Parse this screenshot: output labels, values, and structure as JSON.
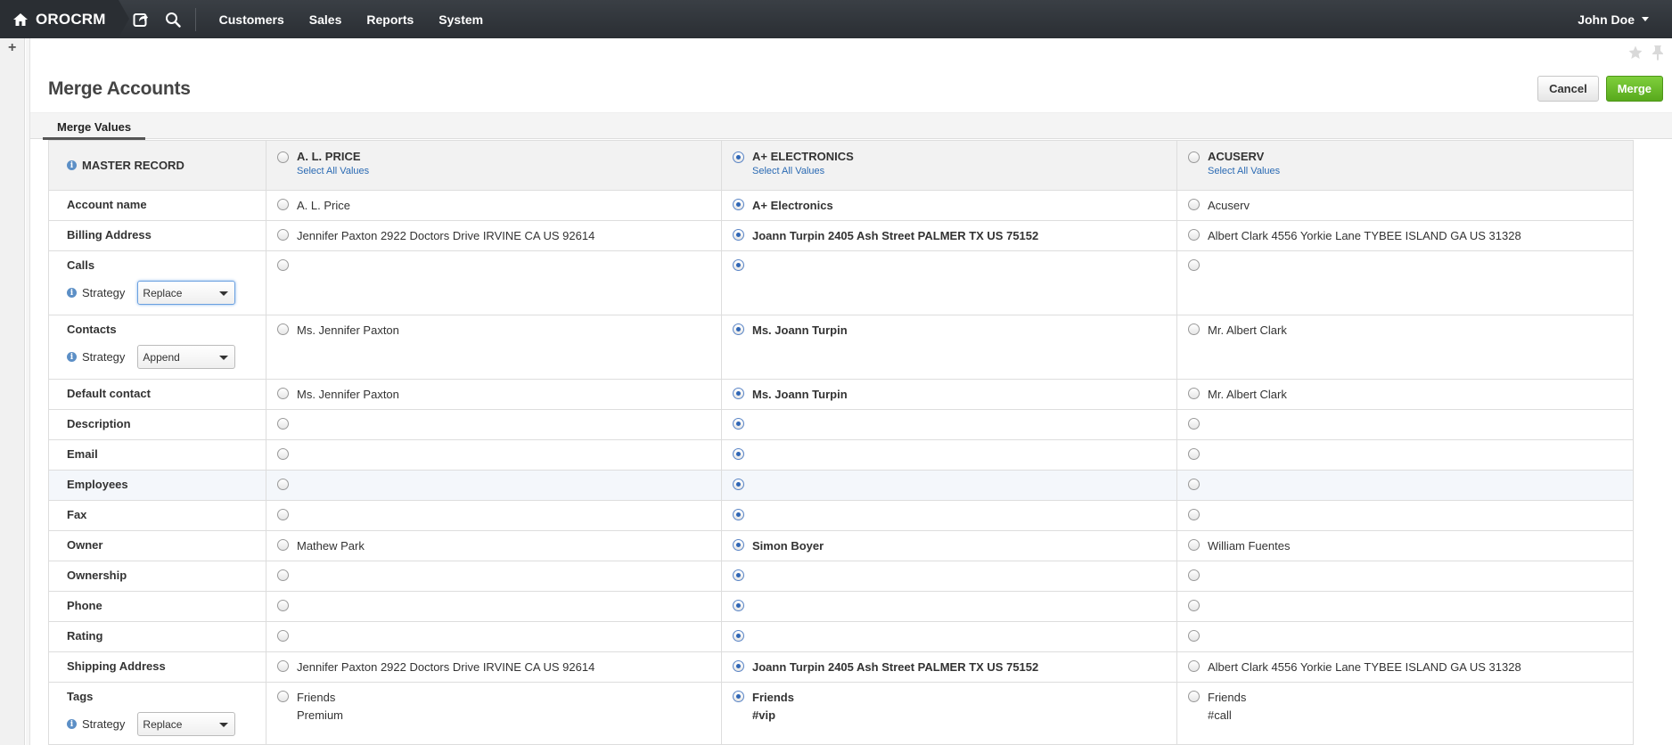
{
  "nav": {
    "brand": "OROCRM",
    "items": [
      "Customers",
      "Sales",
      "Reports",
      "System"
    ],
    "user": "John Doe"
  },
  "page": {
    "title": "Merge Accounts",
    "cancel_label": "Cancel",
    "merge_label": "Merge",
    "tab_label": "Merge Values"
  },
  "table": {
    "master_label": "MASTER RECORD",
    "select_all_label": "Select All Values",
    "strategy_label": "Strategy",
    "columns": [
      "A. L. PRICE",
      "A+ ELECTRONICS",
      "ACUSERV"
    ],
    "rows": [
      {
        "label": "Account name",
        "values": [
          "A. L. Price",
          "A+ Electronics",
          "Acuserv"
        ]
      },
      {
        "label": "Billing Address",
        "values": [
          "Jennifer Paxton 2922 Doctors Drive IRVINE CA US 92614",
          "Joann Turpin 2405 Ash Street PALMER TX US 75152",
          "Albert Clark 4556 Yorkie Lane TYBEE ISLAND GA US 31328"
        ]
      },
      {
        "label": "Calls",
        "strategy": "Replace",
        "values": [
          "",
          "",
          ""
        ]
      },
      {
        "label": "Contacts",
        "strategy": "Append",
        "values": [
          "Ms. Jennifer Paxton",
          "Ms. Joann Turpin",
          "Mr. Albert Clark"
        ]
      },
      {
        "label": "Default contact",
        "values": [
          "Ms. Jennifer Paxton",
          "Ms. Joann Turpin",
          "Mr. Albert Clark"
        ]
      },
      {
        "label": "Description",
        "values": [
          "",
          "",
          ""
        ]
      },
      {
        "label": "Email",
        "values": [
          "",
          "",
          ""
        ]
      },
      {
        "label": "Employees",
        "values": [
          "",
          "",
          ""
        ]
      },
      {
        "label": "Fax",
        "values": [
          "",
          "",
          ""
        ]
      },
      {
        "label": "Owner",
        "values": [
          "Mathew Park",
          "Simon Boyer",
          "William Fuentes"
        ]
      },
      {
        "label": "Ownership",
        "values": [
          "",
          "",
          ""
        ]
      },
      {
        "label": "Phone",
        "values": [
          "",
          "",
          ""
        ]
      },
      {
        "label": "Rating",
        "values": [
          "",
          "",
          ""
        ]
      },
      {
        "label": "Shipping Address",
        "values": [
          "Jennifer Paxton 2922 Doctors Drive IRVINE CA US 92614",
          "Joann Turpin 2405 Ash Street PALMER TX US 75152",
          "Albert Clark 4556 Yorkie Lane TYBEE ISLAND GA US 31328"
        ]
      },
      {
        "label": "Tags",
        "strategy": "Replace",
        "values": [
          [
            "Friends",
            "Premium"
          ],
          [
            "Friends",
            "#vip"
          ],
          [
            "Friends",
            "#call"
          ]
        ]
      }
    ],
    "selected_column": 1
  },
  "icons": {
    "home": "home-icon",
    "share": "share-icon",
    "search": "search-icon",
    "star": "star-icon",
    "pin": "pin-icon",
    "plus": "plus-icon",
    "info": "info-icon"
  },
  "colors": {
    "topbar": "#2a2e33",
    "merge_button": "#58a91c",
    "link": "#2a6ab3",
    "radio_selected": "#2f66b5"
  }
}
